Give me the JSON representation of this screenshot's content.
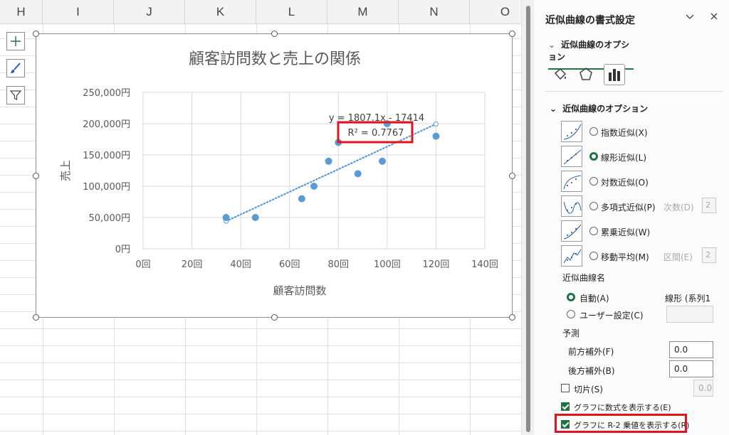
{
  "sheet": {
    "columns": [
      "H",
      "I",
      "J",
      "K",
      "L",
      "M",
      "N",
      "O"
    ]
  },
  "chart_buttons": [
    {
      "icon": "plus-icon"
    },
    {
      "icon": "brush-icon"
    },
    {
      "icon": "filter-icon"
    }
  ],
  "chart_data": {
    "type": "scatter",
    "title": "顧客訪問数と売上の関係",
    "xlabel": "顧客訪問数",
    "ylabel": "売上",
    "xlim": [
      0,
      140
    ],
    "ylim": [
      0,
      250000
    ],
    "x_ticks": [
      "0回",
      "20回",
      "40回",
      "60回",
      "80回",
      "100回",
      "120回",
      "140回"
    ],
    "y_ticks": [
      "0円",
      "50,000円",
      "100,000円",
      "150,000円",
      "200,000円",
      "250,000円"
    ],
    "x_tick_values": [
      0,
      20,
      40,
      60,
      80,
      100,
      120,
      140
    ],
    "y_tick_values": [
      0,
      50000,
      100000,
      150000,
      200000,
      250000
    ],
    "grid": true,
    "points": {
      "x": [
        34,
        46,
        65,
        70,
        76,
        80,
        88,
        98,
        100,
        120
      ],
      "y": [
        50000,
        50000,
        80000,
        100000,
        140000,
        170000,
        120000,
        140000,
        200000,
        180000
      ]
    },
    "trendline": {
      "type": "linear",
      "x_range": [
        34,
        120
      ],
      "slope": 1807.1,
      "intercept": -17414,
      "equation": "y = 1807.1x - 17414",
      "r2": "R² = 0.7767"
    },
    "colors": {
      "marker": "#5b9bd5",
      "trendline": "#5b9bd5",
      "highlight": "#e0141e"
    }
  },
  "pane": {
    "title": "近似曲線の書式設定",
    "dropdown_icon": "chevron-down-icon",
    "close_icon": "close-icon",
    "tab_label": "近似曲線のオプション",
    "tools": [
      {
        "icon": "fill-bucket-icon"
      },
      {
        "icon": "pentagon-icon"
      },
      {
        "icon": "bar-chart-icon"
      }
    ],
    "section_title": "近似曲線のオプション",
    "trend_options": [
      {
        "label": "指数近似(X)",
        "selected": false,
        "extra": "",
        "extra_value": ""
      },
      {
        "label": "線形近似(L)",
        "selected": true,
        "extra": "",
        "extra_value": ""
      },
      {
        "label": "対数近似(O)",
        "selected": false,
        "extra": "",
        "extra_value": ""
      },
      {
        "label": "多項式近似(P)",
        "selected": false,
        "extra": "次数(D)",
        "extra_value": "2"
      },
      {
        "label": "累乗近似(W)",
        "selected": false,
        "extra": "",
        "extra_value": ""
      },
      {
        "label": "移動平均(M)",
        "selected": false,
        "extra": "区間(E)",
        "extra_value": "2"
      }
    ],
    "name_title": "近似曲線名",
    "name_auto_label": "自動(A)",
    "name_auto_value": "線形 (系列1",
    "name_custom_label": "ユーザー設定(C)",
    "forecast_title": "予測",
    "forward_label": "前方補外(F)",
    "forward_value": "0.0",
    "backward_label": "後方補外(B)",
    "backward_value": "0.0",
    "intercept_label": "切片(S)",
    "intercept_value": "0.0",
    "show_equation_label": "グラフに数式を表示する(E)",
    "show_r2_label": "グラフに R-2 乗値を表示する(R)"
  }
}
